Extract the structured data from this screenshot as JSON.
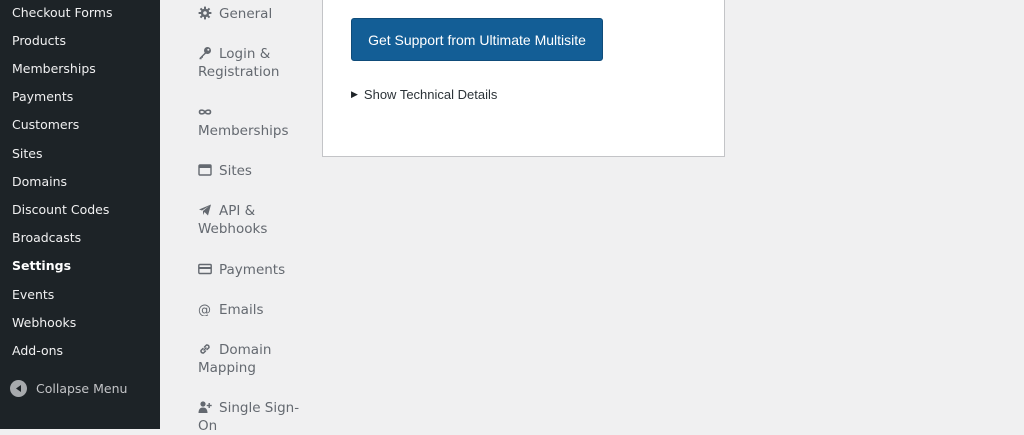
{
  "admin_menu": {
    "items": [
      {
        "label": "Checkout Forms"
      },
      {
        "label": "Products"
      },
      {
        "label": "Memberships"
      },
      {
        "label": "Payments"
      },
      {
        "label": "Customers"
      },
      {
        "label": "Sites"
      },
      {
        "label": "Domains"
      },
      {
        "label": "Discount Codes"
      },
      {
        "label": "Broadcasts"
      },
      {
        "label": "Settings",
        "active": true
      },
      {
        "label": "Events"
      },
      {
        "label": "Webhooks"
      },
      {
        "label": "Add-ons"
      }
    ],
    "collapse_label": "Collapse Menu"
  },
  "settings_nav": {
    "items": [
      {
        "label": "General",
        "icon": "gear-icon"
      },
      {
        "label": "Login & Registration",
        "icon": "key-icon"
      },
      {
        "label": "Memberships",
        "icon": "infinity-icon"
      },
      {
        "label": "Sites",
        "icon": "browser-window-icon"
      },
      {
        "label": "API & Webhooks",
        "icon": "paper-plane-icon"
      },
      {
        "label": "Payments",
        "icon": "credit-card-icon"
      },
      {
        "label": "Emails",
        "icon": "at-sign-icon"
      },
      {
        "label": "Domain Mapping",
        "icon": "link-icon"
      },
      {
        "label": "Single Sign-On",
        "icon": "user-add-icon"
      }
    ]
  },
  "support_card": {
    "button_label": "Get Support from Ultimate Multisite",
    "details_label": "Show Technical Details"
  },
  "colors": {
    "sidebar_bg": "#1d2327",
    "page_bg": "#f0f0f1",
    "primary_button": "#135e96"
  }
}
